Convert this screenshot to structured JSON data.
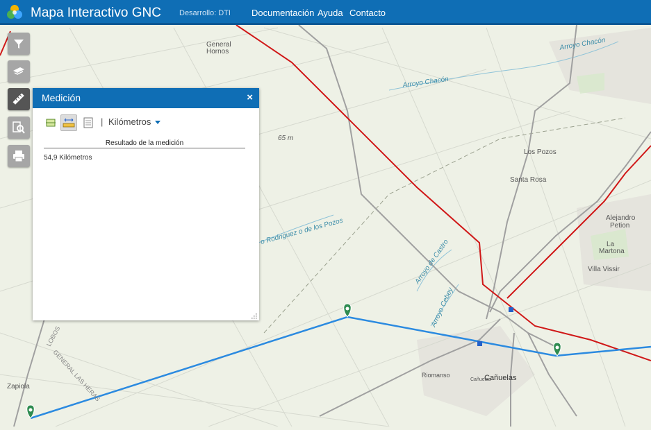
{
  "header": {
    "app_title": "Mapa Interactivo GNC",
    "dev_label": "Desarrollo: DTI",
    "nav": [
      "Documentación",
      "Ayuda",
      "Contacto"
    ]
  },
  "toolbar": {
    "tools": [
      {
        "name": "filter",
        "icon": "filter-icon"
      },
      {
        "name": "basemap",
        "icon": "basemap-icon"
      },
      {
        "name": "measure",
        "icon": "ruler-icon",
        "active": true
      },
      {
        "name": "search",
        "icon": "search-icon"
      },
      {
        "name": "print",
        "icon": "print-icon"
      }
    ]
  },
  "measurement": {
    "title": "Medición",
    "close": "×",
    "separator": "|",
    "unit": "Kilómetros",
    "result_header": "Resultado de la medición",
    "result_value": "54,9 Kilómetros"
  },
  "map": {
    "labels": {
      "general_hornos_1": "General",
      "general_hornos_2": "Hornos",
      "arroyo_chacon_1": "Arroyo Chacón",
      "arroyo_chacon_2": "Arroyo Chacón",
      "elev_65": "65 m",
      "los_pozos": "Los Pozos",
      "santa_rosa": "Santa Rosa",
      "alejandro_petion_1": "Alejandro",
      "alejandro_petion_2": "Petion",
      "la_martona_1": "La",
      "la_martona_2": "Martona",
      "villa_vissir": "Villa Vissir",
      "rodriguez_pozos": "o Rodriguez o de los Pozos",
      "arroyo_castro": "Arroyo de Castro",
      "arroyo_cebey": "Arroyo Cebey",
      "lobos": "LOBOS",
      "general_las_heras": "GENERAL LAS HERAS",
      "zapiola": "Zapiola",
      "romanso": "Riomanso",
      "canuelas_small": "Cañuelas",
      "canuelas": "Cañuelas"
    },
    "colors": {
      "measure_line": "#2b8ae0",
      "boundary": "#d01818",
      "rail": "#9a9a9a",
      "marker": "#2e8b50"
    }
  }
}
